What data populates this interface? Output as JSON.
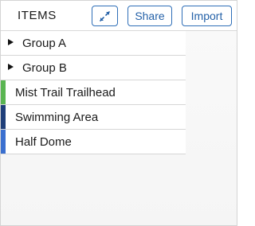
{
  "header": {
    "title": "ITEMS",
    "expand_icon": "expand-arrows-icon",
    "share_label": "Share",
    "import_label": "Import"
  },
  "groups": [
    {
      "label": "Group A",
      "icon": "caret-right-icon"
    },
    {
      "label": "Group B",
      "icon": "caret-right-icon"
    }
  ],
  "items": [
    {
      "label": "Mist Trail Trailhead",
      "color": "#5ab552"
    },
    {
      "label": "Swimming Area",
      "color": "#1f3f7a"
    },
    {
      "label": "Half Dome",
      "color": "#3a6fcf"
    }
  ],
  "colors": {
    "accent": "#2461a8"
  }
}
